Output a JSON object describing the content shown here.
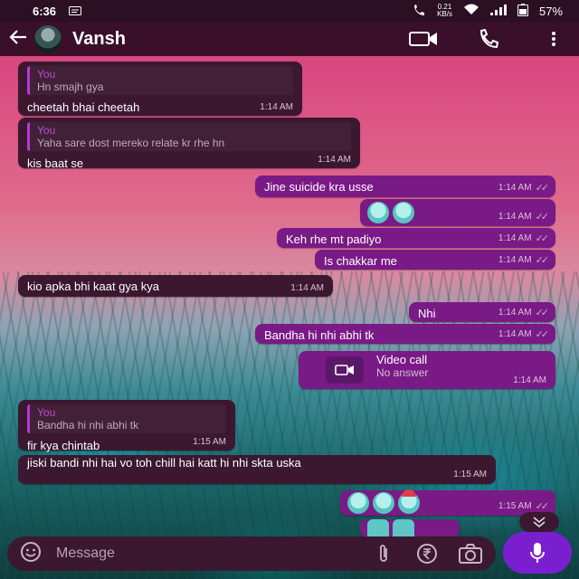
{
  "status_bar": {
    "time": "6:36",
    "net_speed_value": "0.21",
    "net_speed_unit": "KB/s",
    "battery": "57%"
  },
  "header": {
    "contact_name": "Vansh",
    "icons": [
      "back-arrow",
      "avatar",
      "video-call",
      "voice-call",
      "more-vertical"
    ]
  },
  "messages": [
    {
      "dir": "in",
      "quote_author": "You",
      "quote_text": "Hn smajh gya",
      "text": "cheetah bhai cheetah",
      "time": "1:14 AM"
    },
    {
      "dir": "in",
      "quote_author": "You",
      "quote_text": "Yaha sare dost mereko relate kr rhe hn",
      "text": "kis baat se",
      "time": "1:14 AM"
    },
    {
      "dir": "out",
      "text": "Jine suicide kra usse",
      "time": "1:14 AM"
    },
    {
      "dir": "out",
      "text": "",
      "emojis": [
        "cold-sweat-face",
        "cold-sweat-face"
      ],
      "time": "1:14 AM"
    },
    {
      "dir": "out",
      "text": "Keh rhe mt padiyo",
      "time": "1:14 AM"
    },
    {
      "dir": "out",
      "text": "Is chakkar me",
      "time": "1:14 AM"
    },
    {
      "dir": "in",
      "text": "kio apka bhi kaat gya kya",
      "time": "1:14 AM"
    },
    {
      "dir": "out",
      "text": "Nhi",
      "time": "1:14 AM"
    },
    {
      "dir": "out",
      "text": "Bandha hi nhi abhi tk",
      "time": "1:14 AM"
    },
    {
      "dir": "out",
      "type": "call",
      "call_title": "Video call",
      "call_status": "No answer",
      "time": "1:14 AM"
    },
    {
      "dir": "in",
      "quote_author": "You",
      "quote_text": "Bandha hi nhi abhi tk",
      "text": "fir kya chintab",
      "time": "1:15 AM"
    },
    {
      "dir": "in",
      "text": "jiski bandi nhi hai vo toh chill hai katt hi nhi skta uska",
      "time": "1:15 AM"
    },
    {
      "dir": "out",
      "text": "",
      "emojis": [
        "cold-sweat-face",
        "cold-sweat-face",
        "cowboy-face"
      ],
      "time": "1:15 AM"
    },
    {
      "dir": "out",
      "text": "",
      "emojis": [
        "thumbs-up",
        "thumbs-up"
      ],
      "time": ""
    }
  ],
  "input": {
    "placeholder": "Message",
    "icons": [
      "emoji-icon",
      "attach-icon",
      "rupee-icon",
      "camera-icon",
      "mic-icon"
    ]
  },
  "colors": {
    "incoming_bubble": "#3b1830",
    "outgoing_bubble": "#7a1a86",
    "header": "#3a0f2a",
    "mic_button": "#7a1fd0"
  }
}
